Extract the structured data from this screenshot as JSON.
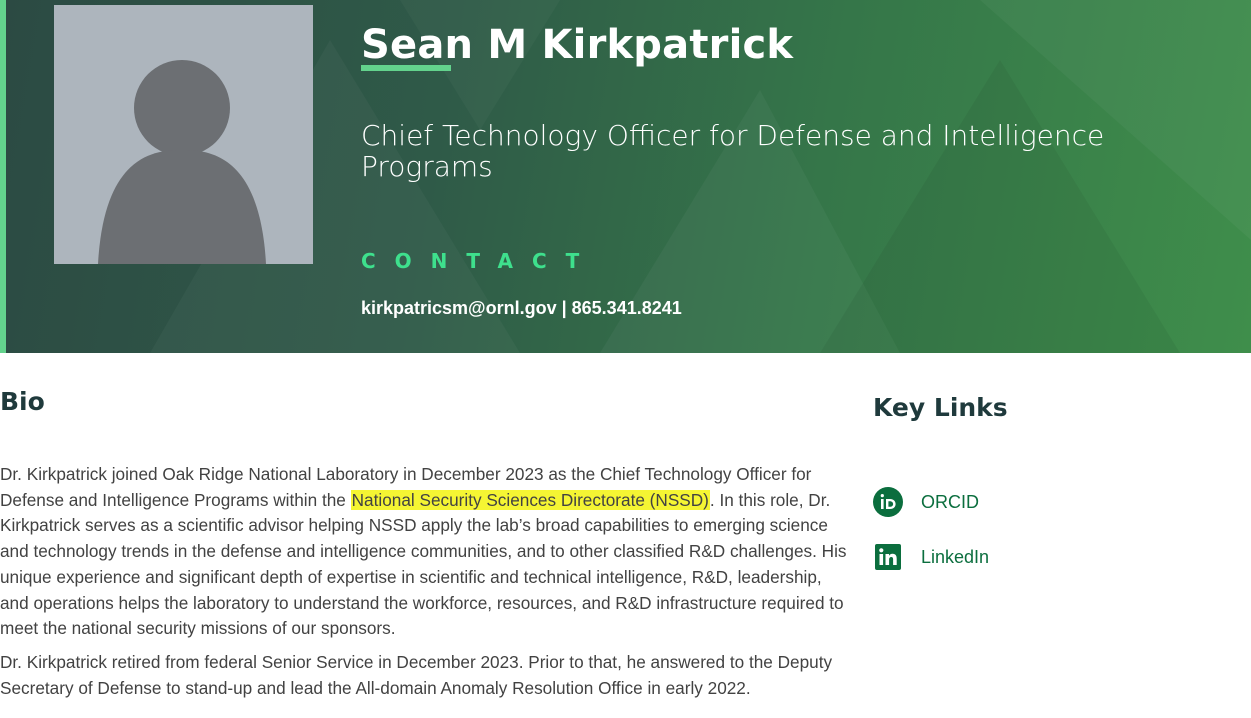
{
  "profile": {
    "name": "Sean M Kirkpatrick",
    "title": "Chief Technology Officer for Defense and Intelligence Programs",
    "contact_heading": "CONTACT",
    "contact_info": "kirkpatricsm@ornl.gov | 865.341.8241",
    "avatar_icon": "person-placeholder-icon"
  },
  "bio": {
    "heading": "Bio",
    "p1_before": "Dr. Kirkpatrick joined Oak Ridge National Laboratory in December 2023 as the Chief Technology Officer for Defense and Intelligence Programs within the ",
    "p1_highlight": "National Security Sciences Directorate (NSSD)",
    "p1_after": ". In this role, Dr. Kirkpatrick serves as a scientific advisor helping NSSD apply the lab’s broad capabilities to emerging science and technology trends in the defense and intelligence communities, and to other classified R&D challenges. His unique experience and significant depth of expertise in scientific and technical intelligence, R&D, leadership, and operations helps the laboratory to understand the workforce, resources, and R&D infrastructure required to meet the national security missions of our sponsors.",
    "p2": "Dr. Kirkpatrick retired from federal Senior Service in December 2023. Prior to that, he answered to the Deputy Secretary of Defense to stand-up and lead the All-domain Anomaly Resolution Office in early 2022."
  },
  "key_links": {
    "heading": "Key Links",
    "items": [
      {
        "label": "ORCID",
        "icon": "orcid-icon"
      },
      {
        "label": "LinkedIn",
        "icon": "linkedin-icon"
      }
    ]
  },
  "colors": {
    "hero_dark": "#2c4a43",
    "hero_green": "#3f8e4b",
    "accent": "#63d38d",
    "contact_heading": "#3ee08d",
    "highlight": "#f5f533",
    "link_green": "#0b6e3e",
    "heading_dark": "#1f3a3c"
  }
}
